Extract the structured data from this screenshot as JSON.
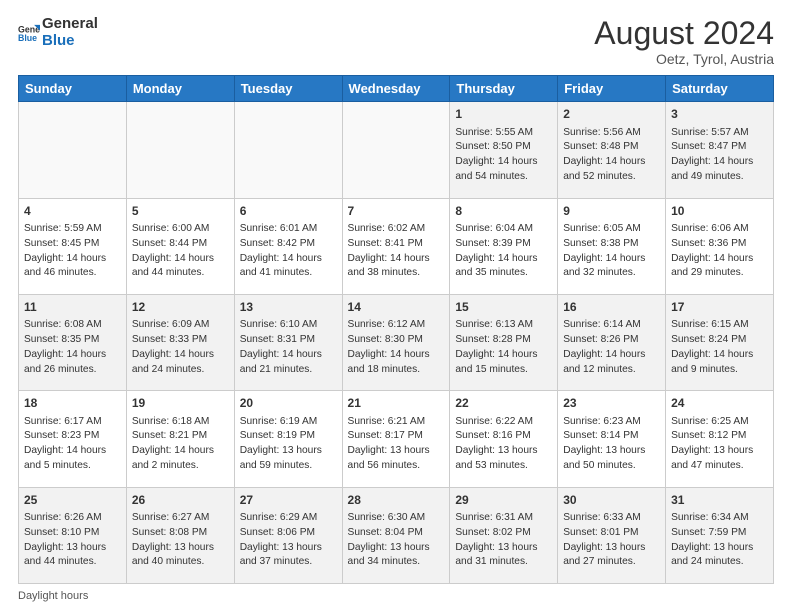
{
  "logo": {
    "line1": "General",
    "line2": "Blue"
  },
  "title": "August 2024",
  "subtitle": "Oetz, Tyrol, Austria",
  "days_header": [
    "Sunday",
    "Monday",
    "Tuesday",
    "Wednesday",
    "Thursday",
    "Friday",
    "Saturday"
  ],
  "footer": "Daylight hours",
  "weeks": [
    [
      {
        "num": "",
        "text": ""
      },
      {
        "num": "",
        "text": ""
      },
      {
        "num": "",
        "text": ""
      },
      {
        "num": "",
        "text": ""
      },
      {
        "num": "1",
        "text": "Sunrise: 5:55 AM\nSunset: 8:50 PM\nDaylight: 14 hours\nand 54 minutes."
      },
      {
        "num": "2",
        "text": "Sunrise: 5:56 AM\nSunset: 8:48 PM\nDaylight: 14 hours\nand 52 minutes."
      },
      {
        "num": "3",
        "text": "Sunrise: 5:57 AM\nSunset: 8:47 PM\nDaylight: 14 hours\nand 49 minutes."
      }
    ],
    [
      {
        "num": "4",
        "text": "Sunrise: 5:59 AM\nSunset: 8:45 PM\nDaylight: 14 hours\nand 46 minutes."
      },
      {
        "num": "5",
        "text": "Sunrise: 6:00 AM\nSunset: 8:44 PM\nDaylight: 14 hours\nand 44 minutes."
      },
      {
        "num": "6",
        "text": "Sunrise: 6:01 AM\nSunset: 8:42 PM\nDaylight: 14 hours\nand 41 minutes."
      },
      {
        "num": "7",
        "text": "Sunrise: 6:02 AM\nSunset: 8:41 PM\nDaylight: 14 hours\nand 38 minutes."
      },
      {
        "num": "8",
        "text": "Sunrise: 6:04 AM\nSunset: 8:39 PM\nDaylight: 14 hours\nand 35 minutes."
      },
      {
        "num": "9",
        "text": "Sunrise: 6:05 AM\nSunset: 8:38 PM\nDaylight: 14 hours\nand 32 minutes."
      },
      {
        "num": "10",
        "text": "Sunrise: 6:06 AM\nSunset: 8:36 PM\nDaylight: 14 hours\nand 29 minutes."
      }
    ],
    [
      {
        "num": "11",
        "text": "Sunrise: 6:08 AM\nSunset: 8:35 PM\nDaylight: 14 hours\nand 26 minutes."
      },
      {
        "num": "12",
        "text": "Sunrise: 6:09 AM\nSunset: 8:33 PM\nDaylight: 14 hours\nand 24 minutes."
      },
      {
        "num": "13",
        "text": "Sunrise: 6:10 AM\nSunset: 8:31 PM\nDaylight: 14 hours\nand 21 minutes."
      },
      {
        "num": "14",
        "text": "Sunrise: 6:12 AM\nSunset: 8:30 PM\nDaylight: 14 hours\nand 18 minutes."
      },
      {
        "num": "15",
        "text": "Sunrise: 6:13 AM\nSunset: 8:28 PM\nDaylight: 14 hours\nand 15 minutes."
      },
      {
        "num": "16",
        "text": "Sunrise: 6:14 AM\nSunset: 8:26 PM\nDaylight: 14 hours\nand 12 minutes."
      },
      {
        "num": "17",
        "text": "Sunrise: 6:15 AM\nSunset: 8:24 PM\nDaylight: 14 hours\nand 9 minutes."
      }
    ],
    [
      {
        "num": "18",
        "text": "Sunrise: 6:17 AM\nSunset: 8:23 PM\nDaylight: 14 hours\nand 5 minutes."
      },
      {
        "num": "19",
        "text": "Sunrise: 6:18 AM\nSunset: 8:21 PM\nDaylight: 14 hours\nand 2 minutes."
      },
      {
        "num": "20",
        "text": "Sunrise: 6:19 AM\nSunset: 8:19 PM\nDaylight: 13 hours\nand 59 minutes."
      },
      {
        "num": "21",
        "text": "Sunrise: 6:21 AM\nSunset: 8:17 PM\nDaylight: 13 hours\nand 56 minutes."
      },
      {
        "num": "22",
        "text": "Sunrise: 6:22 AM\nSunset: 8:16 PM\nDaylight: 13 hours\nand 53 minutes."
      },
      {
        "num": "23",
        "text": "Sunrise: 6:23 AM\nSunset: 8:14 PM\nDaylight: 13 hours\nand 50 minutes."
      },
      {
        "num": "24",
        "text": "Sunrise: 6:25 AM\nSunset: 8:12 PM\nDaylight: 13 hours\nand 47 minutes."
      }
    ],
    [
      {
        "num": "25",
        "text": "Sunrise: 6:26 AM\nSunset: 8:10 PM\nDaylight: 13 hours\nand 44 minutes."
      },
      {
        "num": "26",
        "text": "Sunrise: 6:27 AM\nSunset: 8:08 PM\nDaylight: 13 hours\nand 40 minutes."
      },
      {
        "num": "27",
        "text": "Sunrise: 6:29 AM\nSunset: 8:06 PM\nDaylight: 13 hours\nand 37 minutes."
      },
      {
        "num": "28",
        "text": "Sunrise: 6:30 AM\nSunset: 8:04 PM\nDaylight: 13 hours\nand 34 minutes."
      },
      {
        "num": "29",
        "text": "Sunrise: 6:31 AM\nSunset: 8:02 PM\nDaylight: 13 hours\nand 31 minutes."
      },
      {
        "num": "30",
        "text": "Sunrise: 6:33 AM\nSunset: 8:01 PM\nDaylight: 13 hours\nand 27 minutes."
      },
      {
        "num": "31",
        "text": "Sunrise: 6:34 AM\nSunset: 7:59 PM\nDaylight: 13 hours\nand 24 minutes."
      }
    ]
  ]
}
